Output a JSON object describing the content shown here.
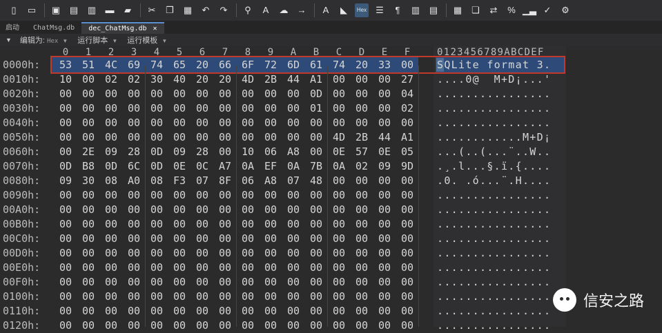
{
  "toolbar": {
    "icons": [
      "new-file-icon",
      "open-folder-icon",
      "save-icon",
      "save-as-icon",
      "save-all-icon",
      "folder-icon",
      "open-folders-icon",
      "cut-icon",
      "copy-icon",
      "paste-icon",
      "undo-icon",
      "redo-icon",
      "find-icon",
      "replace-icon",
      "find-in-files-icon",
      "goto-icon",
      "spellcheck-icon",
      "highlight-icon",
      "hex-toggle-icon",
      "wordwrap-icon",
      "paragraph-icon",
      "column-mode-icon",
      "split-icon",
      "calculator-icon",
      "clipboard-icon",
      "compare-icon",
      "percent-icon",
      "chart-icon",
      "check-icon",
      "macro-icon"
    ],
    "hex_label": "Hex"
  },
  "tabs": [
    {
      "label": "启动",
      "active": false
    },
    {
      "label": "ChatMsg.db",
      "active": false
    },
    {
      "label": "dec_ChatMsg.db",
      "active": true,
      "close": "✕"
    }
  ],
  "options": {
    "edit_as_label": "编辑为:",
    "edit_as_value": "Hex",
    "run_script_label": "运行脚本",
    "run_template_label": "运行模板"
  },
  "hex": {
    "columns": [
      "0",
      "1",
      "2",
      "3",
      "4",
      "5",
      "6",
      "7",
      "8",
      "9",
      "A",
      "B",
      "C",
      "D",
      "E",
      "F"
    ],
    "ascii_header": "0123456789ABCDEF",
    "rows": [
      {
        "offset": "0000h:",
        "bytes": [
          "53",
          "51",
          "4C",
          "69",
          "74",
          "65",
          "20",
          "66",
          "6F",
          "72",
          "6D",
          "61",
          "74",
          "20",
          "33",
          "00"
        ],
        "ascii": "SQLite format 3."
      },
      {
        "offset": "0010h:",
        "bytes": [
          "10",
          "00",
          "02",
          "02",
          "30",
          "40",
          "20",
          "20",
          "4D",
          "2B",
          "44",
          "A1",
          "00",
          "00",
          "00",
          "27"
        ],
        "ascii": "....0@  M+D¡...'"
      },
      {
        "offset": "0020h:",
        "bytes": [
          "00",
          "00",
          "00",
          "00",
          "00",
          "00",
          "00",
          "00",
          "00",
          "00",
          "00",
          "0D",
          "00",
          "00",
          "00",
          "04"
        ],
        "ascii": "................"
      },
      {
        "offset": "0030h:",
        "bytes": [
          "00",
          "00",
          "00",
          "00",
          "00",
          "00",
          "00",
          "00",
          "00",
          "00",
          "00",
          "01",
          "00",
          "00",
          "00",
          "02"
        ],
        "ascii": "................"
      },
      {
        "offset": "0040h:",
        "bytes": [
          "00",
          "00",
          "00",
          "00",
          "00",
          "00",
          "00",
          "00",
          "00",
          "00",
          "00",
          "00",
          "00",
          "00",
          "00",
          "00"
        ],
        "ascii": "................"
      },
      {
        "offset": "0050h:",
        "bytes": [
          "00",
          "00",
          "00",
          "00",
          "00",
          "00",
          "00",
          "00",
          "00",
          "00",
          "00",
          "00",
          "4D",
          "2B",
          "44",
          "A1"
        ],
        "ascii": "............M+D¡"
      },
      {
        "offset": "0060h:",
        "bytes": [
          "00",
          "2E",
          "09",
          "28",
          "0D",
          "09",
          "28",
          "00",
          "10",
          "06",
          "A8",
          "00",
          "0E",
          "57",
          "0E",
          "05"
        ],
        "ascii": "...(..(...¨..W.."
      },
      {
        "offset": "0070h:",
        "bytes": [
          "0D",
          "B8",
          "0D",
          "6C",
          "0D",
          "0E",
          "0C",
          "A7",
          "0A",
          "EF",
          "0A",
          "7B",
          "0A",
          "02",
          "09",
          "9D"
        ],
        "ascii": ".¸.l...§.ï.{...."
      },
      {
        "offset": "0080h:",
        "bytes": [
          "09",
          "30",
          "08",
          "A0",
          "08",
          "F3",
          "07",
          "8F",
          "06",
          "A8",
          "07",
          "48",
          "00",
          "00",
          "00",
          "00"
        ],
        "ascii": ".0. .ó...¨.H...."
      },
      {
        "offset": "0090h:",
        "bytes": [
          "00",
          "00",
          "00",
          "00",
          "00",
          "00",
          "00",
          "00",
          "00",
          "00",
          "00",
          "00",
          "00",
          "00",
          "00",
          "00"
        ],
        "ascii": "................"
      },
      {
        "offset": "00A0h:",
        "bytes": [
          "00",
          "00",
          "00",
          "00",
          "00",
          "00",
          "00",
          "00",
          "00",
          "00",
          "00",
          "00",
          "00",
          "00",
          "00",
          "00"
        ],
        "ascii": "................"
      },
      {
        "offset": "00B0h:",
        "bytes": [
          "00",
          "00",
          "00",
          "00",
          "00",
          "00",
          "00",
          "00",
          "00",
          "00",
          "00",
          "00",
          "00",
          "00",
          "00",
          "00"
        ],
        "ascii": "................"
      },
      {
        "offset": "00C0h:",
        "bytes": [
          "00",
          "00",
          "00",
          "00",
          "00",
          "00",
          "00",
          "00",
          "00",
          "00",
          "00",
          "00",
          "00",
          "00",
          "00",
          "00"
        ],
        "ascii": "................"
      },
      {
        "offset": "00D0h:",
        "bytes": [
          "00",
          "00",
          "00",
          "00",
          "00",
          "00",
          "00",
          "00",
          "00",
          "00",
          "00",
          "00",
          "00",
          "00",
          "00",
          "00"
        ],
        "ascii": "................"
      },
      {
        "offset": "00E0h:",
        "bytes": [
          "00",
          "00",
          "00",
          "00",
          "00",
          "00",
          "00",
          "00",
          "00",
          "00",
          "00",
          "00",
          "00",
          "00",
          "00",
          "00"
        ],
        "ascii": "................"
      },
      {
        "offset": "00F0h:",
        "bytes": [
          "00",
          "00",
          "00",
          "00",
          "00",
          "00",
          "00",
          "00",
          "00",
          "00",
          "00",
          "00",
          "00",
          "00",
          "00",
          "00"
        ],
        "ascii": "................"
      },
      {
        "offset": "0100h:",
        "bytes": [
          "00",
          "00",
          "00",
          "00",
          "00",
          "00",
          "00",
          "00",
          "00",
          "00",
          "00",
          "00",
          "00",
          "00",
          "00",
          "00"
        ],
        "ascii": "................"
      },
      {
        "offset": "0110h:",
        "bytes": [
          "00",
          "00",
          "00",
          "00",
          "00",
          "00",
          "00",
          "00",
          "00",
          "00",
          "00",
          "00",
          "00",
          "00",
          "00",
          "00"
        ],
        "ascii": "................"
      },
      {
        "offset": "0120h:",
        "bytes": [
          "00",
          "00",
          "00",
          "00",
          "00",
          "00",
          "00",
          "00",
          "00",
          "00",
          "00",
          "00",
          "00",
          "00",
          "00",
          "00"
        ],
        "ascii": "................"
      }
    ]
  },
  "watermark": {
    "text": "信安之路"
  },
  "colors": {
    "highlight_border": "#c0392b",
    "selection": "#2e4a78"
  }
}
